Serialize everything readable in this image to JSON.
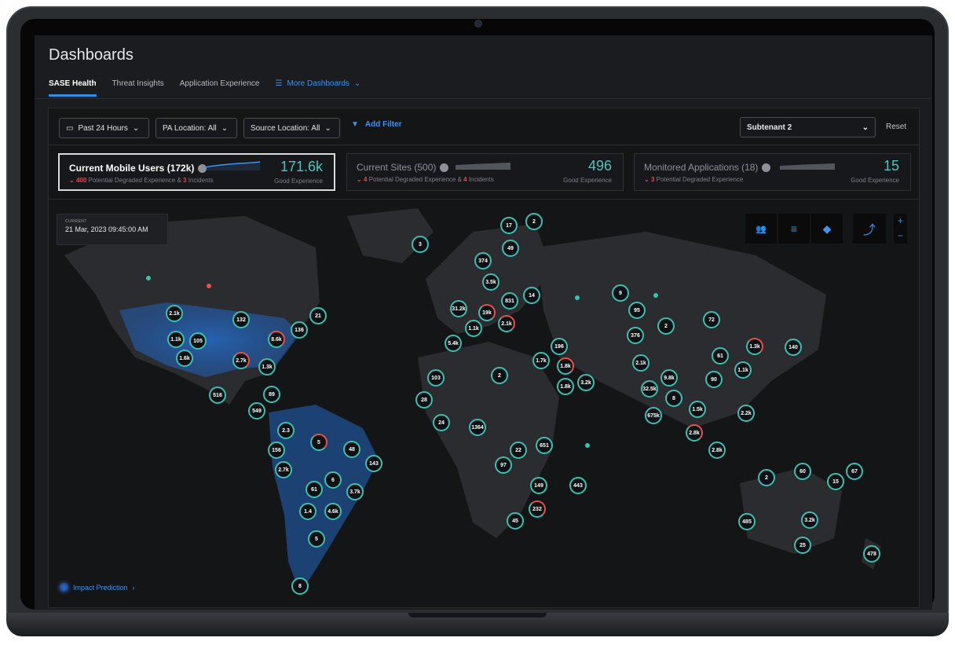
{
  "page": {
    "title": "Dashboards"
  },
  "tabs": [
    {
      "label": "SASE Health",
      "active": true
    },
    {
      "label": "Threat Insights",
      "active": false
    },
    {
      "label": "Application Experience",
      "active": false
    },
    {
      "label": "More Dashboards",
      "active": false
    }
  ],
  "filters": {
    "time": "Past 24 Hours",
    "pa_location": "PA Location: All",
    "source_location": "Source Location: All",
    "add_filter": "Add Filter",
    "subtenant": "Subtenant 2",
    "reset": "Reset"
  },
  "kpis": [
    {
      "title": "Current Mobile Users (172k)",
      "degraded": "400",
      "sub_mid": " Potential Degraded Experience & ",
      "incidents": "3",
      "sub_end": " Incidents",
      "value": "171.6k",
      "value_label": "Good Experience",
      "active": true
    },
    {
      "title": "Current Sites (500)",
      "degraded": "4",
      "sub_mid": " Potential Degraded Experience & ",
      "incidents": "4",
      "sub_end": " Incidents",
      "value": "496",
      "value_label": "Good Experience",
      "active": false
    },
    {
      "title": "Monitored Applications (18)",
      "degraded": "3",
      "sub_mid": " Potential Degraded Experience",
      "incidents": "",
      "sub_end": "",
      "value": "15",
      "value_label": "Good Experience",
      "active": false
    }
  ],
  "map": {
    "timestamp_label": "CURRENT",
    "timestamp": "21 Mar, 2023 09:45:00 AM",
    "zoom_in": "+",
    "zoom_out": "−",
    "impact_prediction": "Impact Prediction",
    "clusters": [
      {
        "label": "3"
      },
      {
        "label": "2.1k"
      },
      {
        "label": "132"
      },
      {
        "label": "21"
      },
      {
        "label": "136"
      },
      {
        "label": "8.6k"
      },
      {
        "label": "1.1k"
      },
      {
        "label": "105"
      },
      {
        "label": "1.6k"
      },
      {
        "label": "2.7k"
      },
      {
        "label": "1.3k"
      },
      {
        "label": "516"
      },
      {
        "label": "89"
      },
      {
        "label": "549"
      },
      {
        "label": "2.3"
      },
      {
        "label": "5"
      },
      {
        "label": "156"
      },
      {
        "label": "48"
      },
      {
        "label": "143"
      },
      {
        "label": "2.7k"
      },
      {
        "label": "6"
      },
      {
        "label": "61"
      },
      {
        "label": "3.7k"
      },
      {
        "label": "1.4"
      },
      {
        "label": "4.6k"
      },
      {
        "label": "5"
      },
      {
        "label": "8"
      },
      {
        "label": "17"
      },
      {
        "label": "2"
      },
      {
        "label": "49"
      },
      {
        "label": "374"
      },
      {
        "label": "3.5k"
      },
      {
        "label": "831"
      },
      {
        "label": "14"
      },
      {
        "label": "31.2k"
      },
      {
        "label": "19k"
      },
      {
        "label": "1.1k"
      },
      {
        "label": "2.1k"
      },
      {
        "label": "5.4k"
      },
      {
        "label": "196"
      },
      {
        "label": "1.7k"
      },
      {
        "label": "1.8k"
      },
      {
        "label": "1.8k"
      },
      {
        "label": "3.2k"
      },
      {
        "label": "2"
      },
      {
        "label": "103"
      },
      {
        "label": "28"
      },
      {
        "label": "24"
      },
      {
        "label": "1364"
      },
      {
        "label": "22"
      },
      {
        "label": "651"
      },
      {
        "label": "97"
      },
      {
        "label": "149"
      },
      {
        "label": "443"
      },
      {
        "label": "232"
      },
      {
        "label": "45"
      },
      {
        "label": "9"
      },
      {
        "label": "95"
      },
      {
        "label": "2"
      },
      {
        "label": "72"
      },
      {
        "label": "376"
      },
      {
        "label": "2.1k"
      },
      {
        "label": "61"
      },
      {
        "label": "1.3k"
      },
      {
        "label": "140"
      },
      {
        "label": "1.1k"
      },
      {
        "label": "9.8k"
      },
      {
        "label": "90"
      },
      {
        "label": "32.5k"
      },
      {
        "label": "8"
      },
      {
        "label": "675k"
      },
      {
        "label": "1.5k"
      },
      {
        "label": "2.2k"
      },
      {
        "label": "2.8k"
      },
      {
        "label": "2.8k"
      },
      {
        "label": "2"
      },
      {
        "label": "60"
      },
      {
        "label": "15"
      },
      {
        "label": "67"
      },
      {
        "label": "485"
      },
      {
        "label": "3.2k"
      },
      {
        "label": "25"
      },
      {
        "label": "478"
      }
    ]
  },
  "colors": {
    "accent": "#3b95f0",
    "good": "#4cc6b9",
    "alert": "#e44b4b"
  }
}
